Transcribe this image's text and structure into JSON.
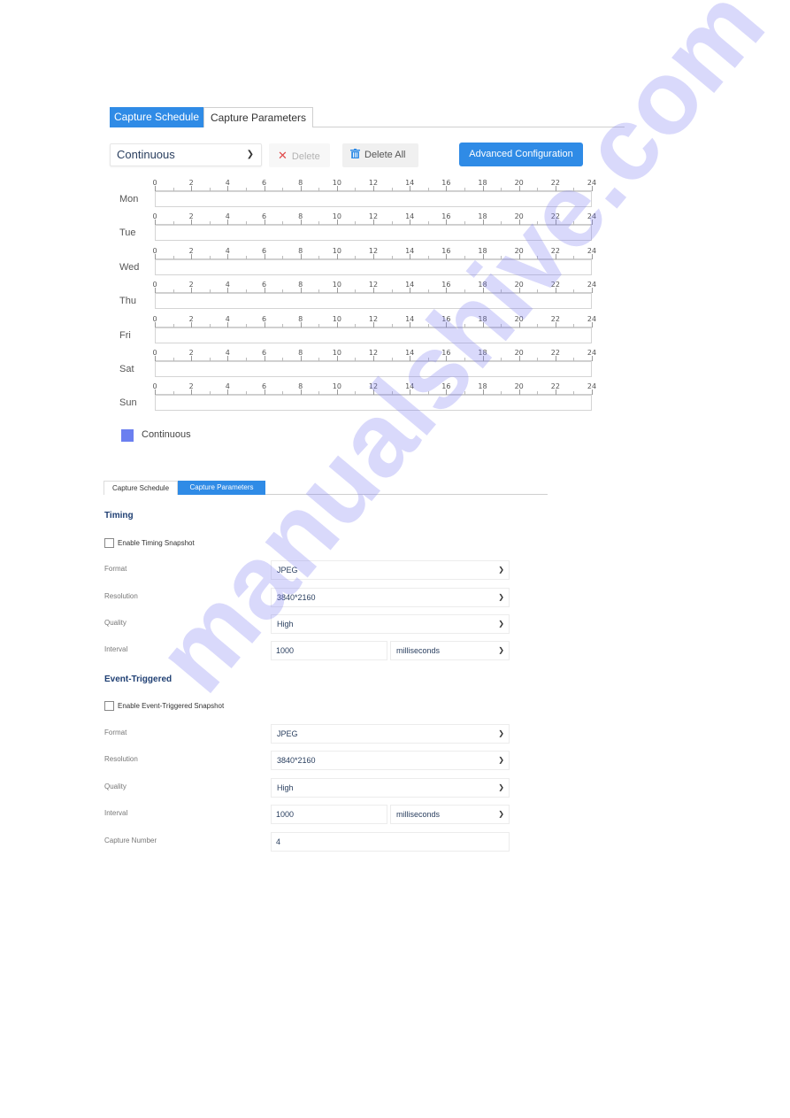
{
  "schedule_panel": {
    "tabs": [
      {
        "label": "Capture Schedule",
        "active": true
      },
      {
        "label": "Capture Parameters",
        "active": false
      }
    ],
    "toolbar": {
      "mode_select": {
        "value": "Continuous",
        "icon": "chevron-down-icon"
      },
      "delete_label": "Delete",
      "delete_icon": "close-icon",
      "delete_all_label": "Delete All",
      "delete_all_icon": "trash-icon",
      "advanced_label": "Advanced Configuration"
    },
    "hour_ticks": [
      "0",
      "2",
      "4",
      "6",
      "8",
      "10",
      "12",
      "14",
      "16",
      "18",
      "20",
      "22",
      "24"
    ],
    "days": [
      {
        "label": "Mon",
        "segments": []
      },
      {
        "label": "Tue",
        "segments": []
      },
      {
        "label": "Wed",
        "segments": []
      },
      {
        "label": "Thu",
        "segments": []
      },
      {
        "label": "Fri",
        "segments": []
      },
      {
        "label": "Sat",
        "segments": []
      },
      {
        "label": "Sun",
        "segments": []
      }
    ],
    "legend": {
      "label": "Continuous",
      "color": "#6b7ff0"
    }
  },
  "params_panel": {
    "tabs": [
      {
        "label": "Capture Schedule",
        "active": false
      },
      {
        "label": "Capture Parameters",
        "active": true
      }
    ],
    "timing": {
      "title": "Timing",
      "enable_label": "Enable Timing Snapshot",
      "enabled": false,
      "format_label": "Format",
      "format_value": "JPEG",
      "resolution_label": "Resolution",
      "resolution_value": "3840*2160",
      "quality_label": "Quality",
      "quality_value": "High",
      "interval_label": "Interval",
      "interval_value": "1000",
      "interval_unit": "milliseconds"
    },
    "event": {
      "title": "Event-Triggered",
      "enable_label": "Enable Event-Triggered Snapshot",
      "enabled": false,
      "format_label": "Format",
      "format_value": "JPEG",
      "resolution_label": "Resolution",
      "resolution_value": "3840*2160",
      "quality_label": "Quality",
      "quality_value": "High",
      "interval_label": "Interval",
      "interval_value": "1000",
      "interval_unit": "milliseconds",
      "capture_number_label": "Capture Number",
      "capture_number_value": "4"
    }
  },
  "colors": {
    "accent": "#2f8be6",
    "heading": "#1f3f73",
    "danger": "#e04b4b"
  },
  "watermark": "manualshive.com"
}
